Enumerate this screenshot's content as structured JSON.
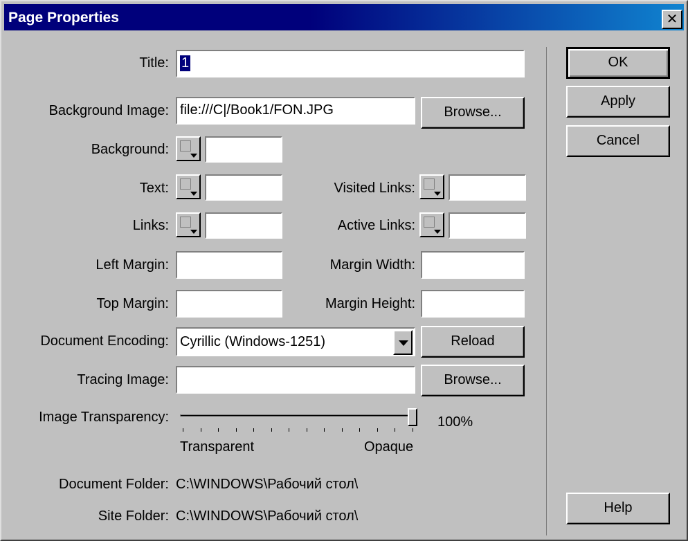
{
  "window": {
    "title": "Page Properties",
    "close_glyph": "✕"
  },
  "labels": {
    "title": "Title:",
    "background_image": "Background Image:",
    "background": "Background:",
    "text": "Text:",
    "links": "Links:",
    "visited_links": "Visited Links:",
    "active_links": "Active Links:",
    "left_margin": "Left Margin:",
    "top_margin": "Top Margin:",
    "margin_width": "Margin Width:",
    "margin_height": "Margin Height:",
    "document_encoding": "Document Encoding:",
    "tracing_image": "Tracing Image:",
    "image_transparency": "Image Transparency:",
    "document_folder": "Document Folder:",
    "site_folder": "Site Folder:"
  },
  "fields": {
    "title_value": "1",
    "background_image_value": "file:///C|/Book1/FON.JPG",
    "background_value": "",
    "text_value": "",
    "links_value": "",
    "visited_links_value": "",
    "active_links_value": "",
    "left_margin_value": "",
    "top_margin_value": "",
    "margin_width_value": "",
    "margin_height_value": "",
    "encoding_value": "Cyrillic (Windows-1251)",
    "tracing_image_value": ""
  },
  "buttons": {
    "ok": "OK",
    "apply": "Apply",
    "cancel": "Cancel",
    "help": "Help",
    "browse_background": "Browse...",
    "reload": "Reload",
    "browse_tracing": "Browse..."
  },
  "slider": {
    "value_text": "100%",
    "value": 1.0,
    "min_label": "Transparent",
    "max_label": "Opaque",
    "tick_count": 14
  },
  "info": {
    "document_folder": "C:\\WINDOWS\\Рабочий стол\\",
    "site_folder": "C:\\WINDOWS\\Рабочий стол\\"
  },
  "icons": {
    "dropdown": "chevron-down-icon",
    "color_picker": "color-swatch-icon"
  }
}
